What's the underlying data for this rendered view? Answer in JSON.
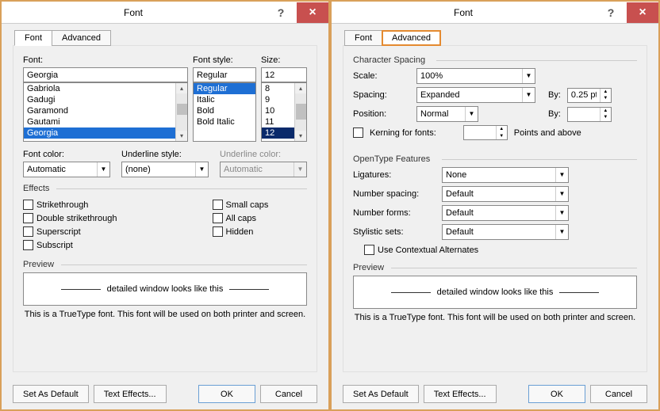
{
  "shared": {
    "window_title": "Font",
    "help_icon": "?",
    "close_icon": "×",
    "tabs": {
      "font": "Font",
      "advanced": "Advanced"
    },
    "preview_label": "Preview",
    "preview_text": "detailed window looks like this",
    "preview_desc": "This is a TrueType font. This font will be used on both printer and screen.",
    "set_default": "Set As Default",
    "text_effects": "Text Effects...",
    "ok": "OK",
    "cancel": "Cancel"
  },
  "left": {
    "font_label": "Font:",
    "font_style_label": "Font style:",
    "size_label": "Size:",
    "font_value": "Georgia",
    "fonts": [
      "Gabriola",
      "Gadugi",
      "Garamond",
      "Gautami",
      "Georgia"
    ],
    "style_value": "Regular",
    "styles": [
      "Regular",
      "Italic",
      "Bold",
      "Bold Italic"
    ],
    "size_value": "12",
    "sizes": [
      "8",
      "9",
      "10",
      "11",
      "12"
    ],
    "font_color_label": "Font color:",
    "font_color_value": "Automatic",
    "underline_style_label": "Underline style:",
    "underline_style_value": "(none)",
    "underline_color_label": "Underline color:",
    "underline_color_value": "Automatic",
    "effects_label": "Effects",
    "effects_col1": [
      "Strikethrough",
      "Double strikethrough",
      "Superscript",
      "Subscript"
    ],
    "effects_col2": [
      "Small caps",
      "All caps",
      "Hidden"
    ]
  },
  "right": {
    "char_spacing_label": "Character Spacing",
    "scale_label": "Scale:",
    "scale_value": "100%",
    "spacing_label": "Spacing:",
    "spacing_value": "Expanded",
    "by_label": "By:",
    "spacing_by_value": "0.25 pt",
    "position_label": "Position:",
    "position_value": "Normal",
    "position_by_value": "",
    "kerning_label": "Kerning for fonts:",
    "kerning_unit": "Points and above",
    "opentype_label": "OpenType Features",
    "ligatures_label": "Ligatures:",
    "ligatures_value": "None",
    "numspacing_label": "Number spacing:",
    "numspacing_value": "Default",
    "numforms_label": "Number forms:",
    "numforms_value": "Default",
    "stylistic_label": "Stylistic sets:",
    "stylistic_value": "Default",
    "contextual_label": "Use Contextual Alternates"
  }
}
